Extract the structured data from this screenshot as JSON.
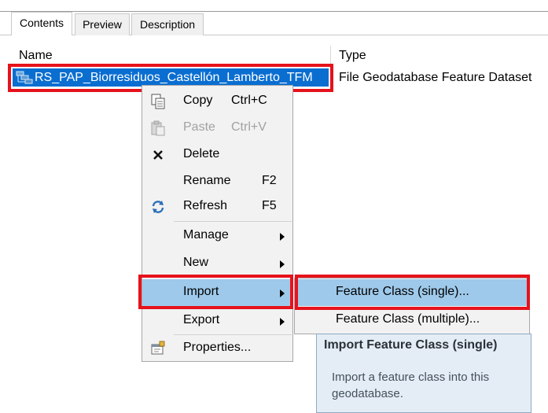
{
  "tabs": [
    {
      "label": "Contents"
    },
    {
      "label": "Preview"
    },
    {
      "label": "Description"
    }
  ],
  "columns": {
    "name": "Name",
    "type": "Type"
  },
  "dataset": {
    "name": "RS_PAP_Biorresiduos_Castellón_Lamberto_TFM",
    "type": "File Geodatabase Feature Dataset"
  },
  "context_menu": {
    "items": [
      {
        "label": "Copy",
        "shortcut": "Ctrl+C",
        "icon": "copy-icon",
        "enabled": true
      },
      {
        "label": "Paste",
        "shortcut": "Ctrl+V",
        "icon": "paste-icon",
        "enabled": false
      },
      {
        "label": "Delete",
        "shortcut": "",
        "icon": "delete-icon",
        "enabled": true
      },
      {
        "label": "Rename",
        "shortcut": "F2",
        "icon": "",
        "enabled": true
      },
      {
        "label": "Refresh",
        "shortcut": "F5",
        "icon": "refresh-icon",
        "enabled": true
      },
      {
        "label": "Manage",
        "shortcut": "",
        "icon": "",
        "enabled": true,
        "submenu": true
      },
      {
        "label": "New",
        "shortcut": "",
        "icon": "",
        "enabled": true,
        "submenu": true
      },
      {
        "label": "Import",
        "shortcut": "",
        "icon": "",
        "enabled": true,
        "submenu": true,
        "highlighted": true
      },
      {
        "label": "Export",
        "shortcut": "",
        "icon": "",
        "enabled": true,
        "submenu": true
      },
      {
        "label": "Properties...",
        "shortcut": "",
        "icon": "properties-icon",
        "enabled": true
      }
    ]
  },
  "import_submenu": {
    "items": [
      {
        "label": "Feature Class (single)...",
        "highlighted": true
      },
      {
        "label": "Feature Class (multiple)..."
      }
    ]
  },
  "tooltip": {
    "title": "Import Feature Class (single)",
    "body": "Import a feature class into this geodatabase."
  },
  "colors": {
    "selection": "#0a6ed1",
    "highlight": "#9ec9ea",
    "annotation_red": "#e6121b"
  }
}
